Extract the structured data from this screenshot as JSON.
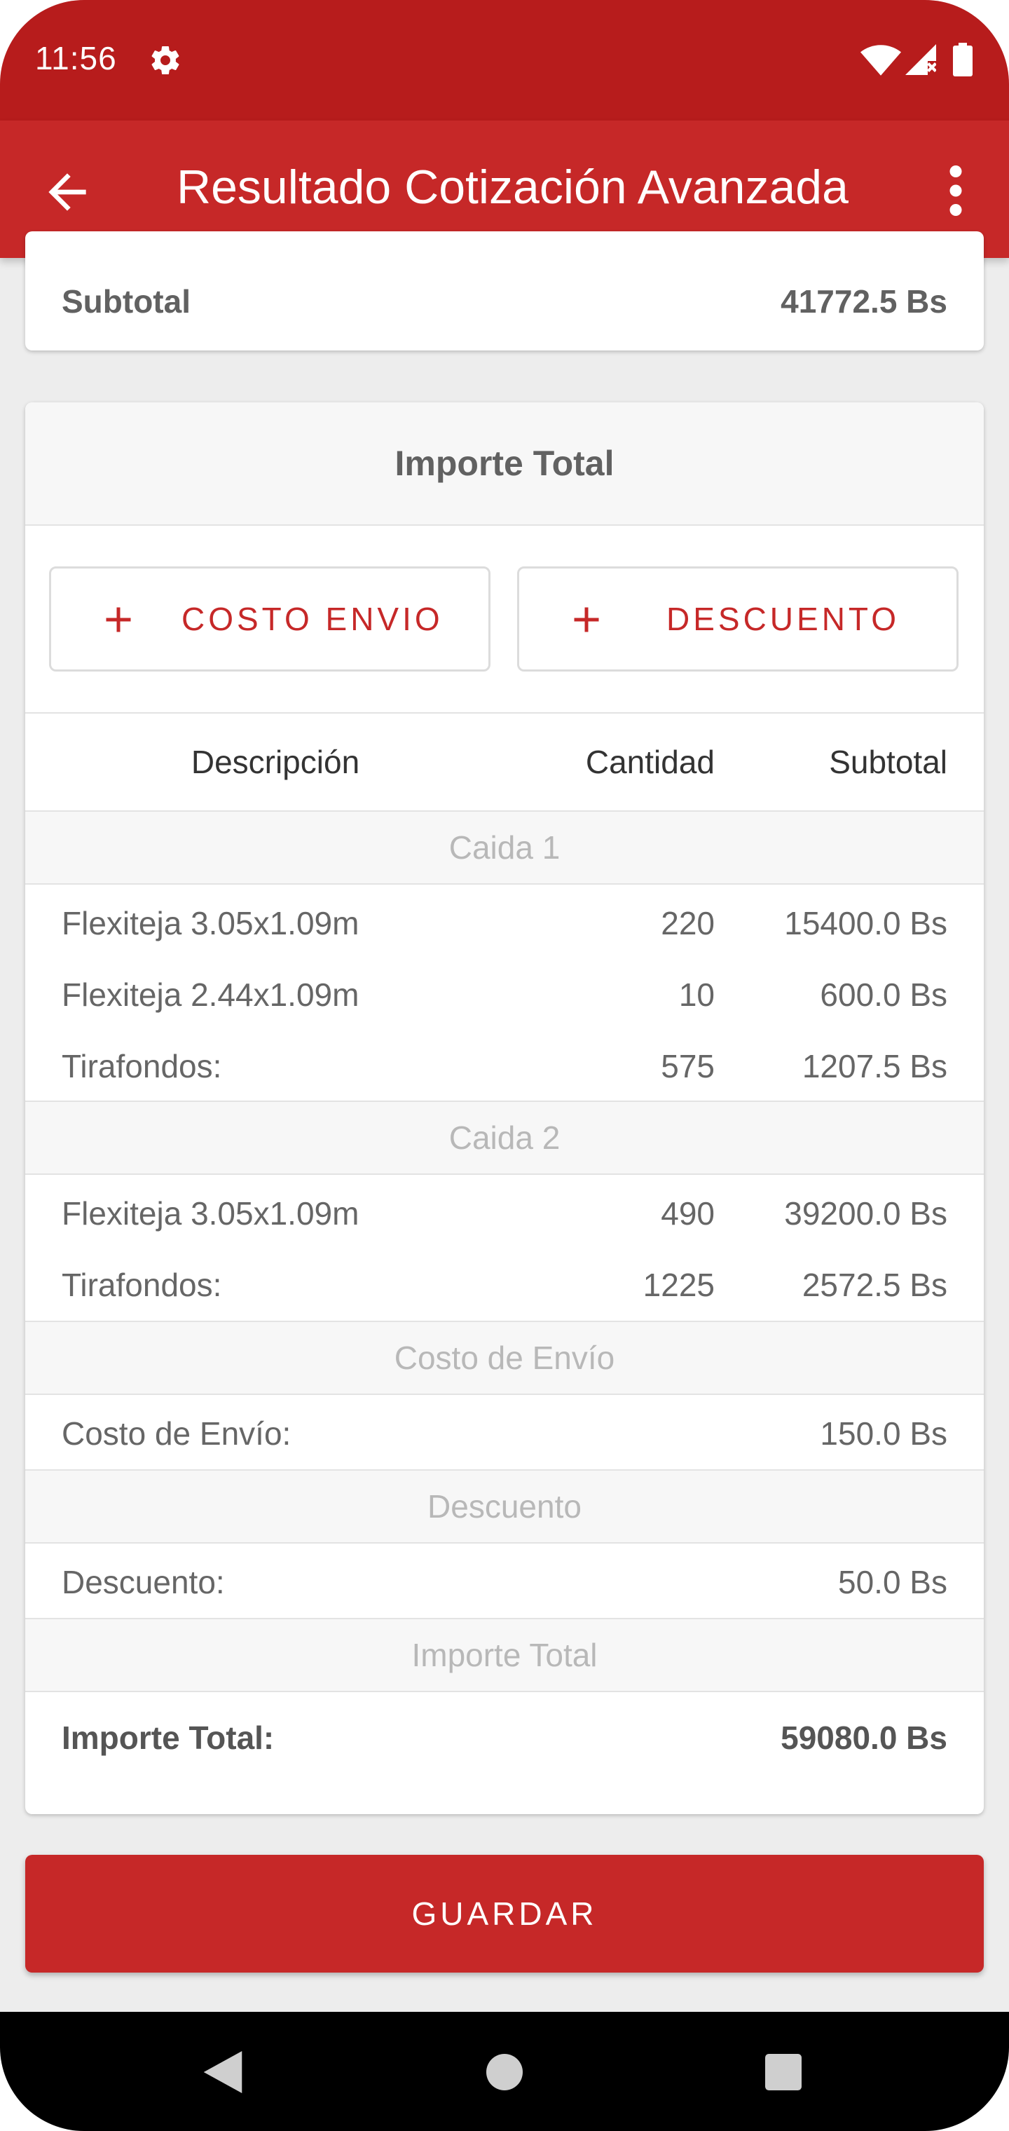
{
  "status_bar": {
    "time": "11:56"
  },
  "app_bar": {
    "title": "Resultado Cotización Avanzada"
  },
  "subtotal_card": {
    "label": "Subtotal",
    "value": "41772.5 Bs"
  },
  "total_card": {
    "header": "Importe Total",
    "buttons": {
      "costo_envio": "COSTO ENVIO",
      "descuento": "DESCUENTO"
    },
    "columns": {
      "descripcion": "Descripción",
      "cantidad": "Cantidad",
      "subtotal": "Subtotal"
    },
    "sections": [
      {
        "title": "Caida 1"
      },
      {
        "title": "Caida 2"
      },
      {
        "title": "Costo de Envío"
      },
      {
        "title": "Descuento"
      },
      {
        "title": "Importe Total"
      }
    ],
    "rows": [
      {
        "desc": "Flexiteja 3.05x1.09m",
        "qty": "220",
        "subtotal": "15400.0 Bs"
      },
      {
        "desc": "Flexiteja 2.44x1.09m",
        "qty": "10",
        "subtotal": "600.0 Bs"
      },
      {
        "desc": "Tirafondos:",
        "qty": "575",
        "subtotal": "1207.5 Bs"
      },
      {
        "desc": "Flexiteja 3.05x1.09m",
        "qty": "490",
        "subtotal": "39200.0 Bs"
      },
      {
        "desc": "Tirafondos:",
        "qty": "1225",
        "subtotal": "2572.5 Bs"
      },
      {
        "desc": "Costo de Envío:",
        "qty": "",
        "subtotal": "150.0 Bs"
      },
      {
        "desc": "Descuento:",
        "qty": "",
        "subtotal": "50.0 Bs"
      },
      {
        "desc": "Importe Total:",
        "qty": "",
        "subtotal": "59080.0 Bs"
      }
    ]
  },
  "save_button": {
    "label": "GUARDAR"
  },
  "colors": {
    "primary": "#c62828",
    "primary_dark": "#b71c1c",
    "background": "#ededed"
  }
}
